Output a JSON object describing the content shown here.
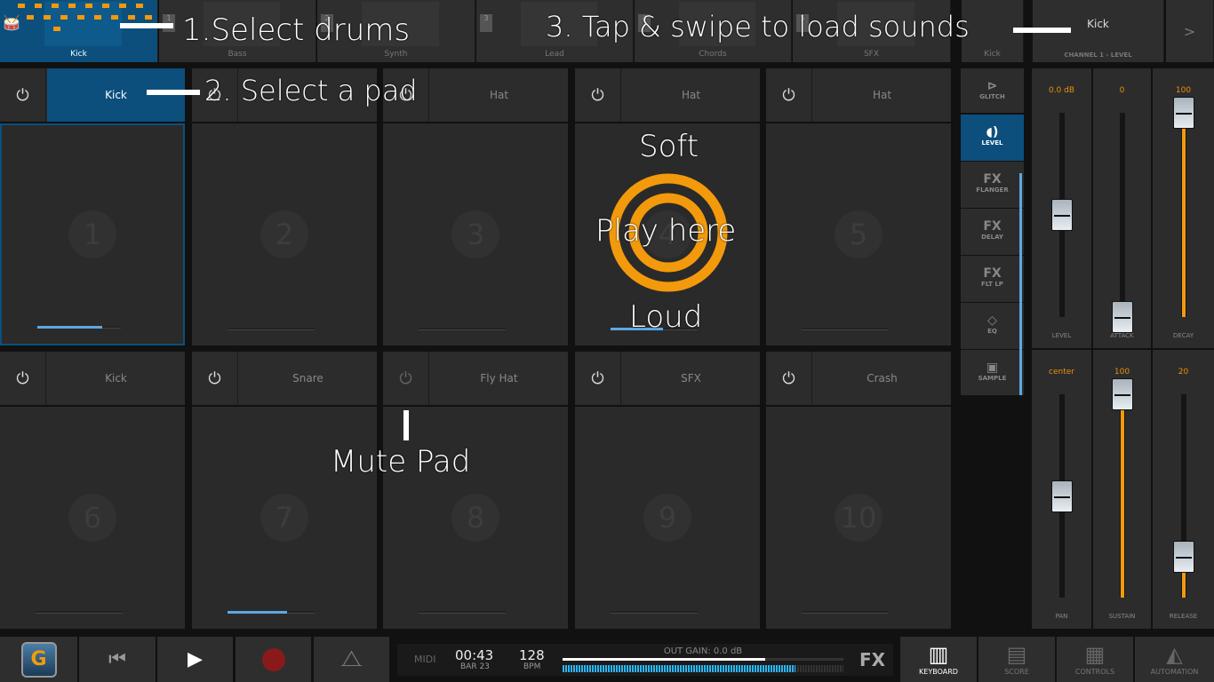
{
  "tracks": [
    {
      "label": "Kick",
      "selected": true
    },
    {
      "label": "Bass",
      "num": "1"
    },
    {
      "label": "Synth",
      "num": "2"
    },
    {
      "label": "Lead",
      "num": "3"
    },
    {
      "label": "Chords",
      "num": "4"
    },
    {
      "label": "SFX",
      "num": "5"
    }
  ],
  "mini_track": {
    "label": "Kick"
  },
  "channel": {
    "sound": "Kick",
    "label": "CHANNEL 1 - LEVEL",
    "next": ">"
  },
  "pads": [
    {
      "name": "Kick",
      "number": "1",
      "selected": true,
      "level": 0.78
    },
    {
      "name": "",
      "number": "2",
      "level": 0
    },
    {
      "name": "Hat",
      "number": "3",
      "level": 0
    },
    {
      "name": "Hat",
      "number": "4",
      "level": 0.6
    },
    {
      "name": "Hat",
      "number": "5",
      "level": 0
    },
    {
      "name": "Kick",
      "number": "6",
      "level": 0
    },
    {
      "name": "Snare",
      "number": "7",
      "level": 0.68
    },
    {
      "name": "Fly Hat",
      "number": "8",
      "level": 0,
      "muted": true
    },
    {
      "name": "SFX",
      "number": "9",
      "level": 0
    },
    {
      "name": "Crash",
      "number": "10",
      "level": 0
    }
  ],
  "side_menu": [
    {
      "label": "GLITCH",
      "icon": "glitch-icon",
      "glyph": "⊳"
    },
    {
      "label": "LEVEL",
      "icon": "speaker-icon",
      "glyph": "◖)",
      "selected": true
    },
    {
      "label": "FLANGER",
      "icon": "fx-icon",
      "glyph": "FX"
    },
    {
      "label": "DELAY",
      "icon": "fx-icon",
      "glyph": "FX"
    },
    {
      "label": "FLT LP",
      "icon": "fx-icon",
      "glyph": "FX"
    },
    {
      "label": "EQ",
      "icon": "eq-icon",
      "glyph": "◇"
    },
    {
      "label": "SAMPLE",
      "icon": "sample-icon",
      "glyph": "▣"
    }
  ],
  "faders": [
    {
      "label": "LEVEL",
      "value": "0.0 dB",
      "position": 0.5,
      "fill": false
    },
    {
      "label": "ATTACK",
      "value": "0",
      "position": 0.0,
      "fill": false
    },
    {
      "label": "DECAY",
      "value": "100",
      "position": 1.0,
      "fill": true
    },
    {
      "label": "PAN",
      "value": "center",
      "position": 0.5,
      "fill": false
    },
    {
      "label": "SUSTAIN",
      "value": "100",
      "position": 1.0,
      "fill": true
    },
    {
      "label": "RELEASE",
      "value": "20",
      "position": 0.2,
      "fill": true
    }
  ],
  "transport": {
    "midi": "MIDI",
    "time": "00:43",
    "bar": "BAR 23",
    "bpm": "128",
    "bpm_label": "BPM",
    "out_gain": "OUT GAIN: 0.0 dB",
    "gain_level": 0.72,
    "meter_level": 0.83,
    "fx": "FX"
  },
  "bottom_tabs": [
    {
      "label": "KEYBOARD",
      "icon": "keyboard-icon",
      "active": true
    },
    {
      "label": "SCORE",
      "icon": "score-icon"
    },
    {
      "label": "CONTROLS",
      "icon": "controls-icon"
    },
    {
      "label": "AUTOMATION",
      "icon": "automation-icon"
    }
  ],
  "annotations": {
    "select_drums": "1.Select drums",
    "select_pad": "2. Select a pad",
    "load_sounds": "3. Tap & swipe to load sounds",
    "mute_pad": "Mute Pad",
    "soft": "Soft",
    "play_here": "Play here",
    "loud": "Loud"
  },
  "colors": {
    "accent": "#0c4f7c",
    "orange": "#f29a0c",
    "meter": "#29b6f6"
  }
}
